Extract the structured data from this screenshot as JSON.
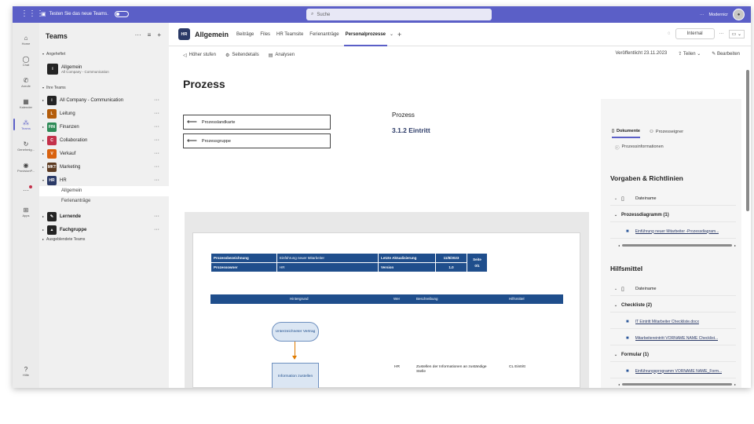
{
  "topbar": {
    "promo_text": "Testen Sie das neue Teams.",
    "search_placeholder": "Suche",
    "more": "···",
    "org": "Modernicr"
  },
  "rail": [
    {
      "id": "home",
      "label": "Home",
      "icon": "home-icon",
      "glyph": "⌂"
    },
    {
      "id": "chat",
      "label": "Chat",
      "icon": "chat-icon",
      "glyph": "◯"
    },
    {
      "id": "anrufe",
      "label": "Anrufe",
      "icon": "phone-icon",
      "glyph": "✆"
    },
    {
      "id": "kalender",
      "label": "Kalender",
      "icon": "calendar-icon",
      "glyph": "▦"
    },
    {
      "id": "teams",
      "label": "Teams",
      "icon": "teams-icon",
      "glyph": "⁂"
    },
    {
      "id": "genehmig",
      "label": "Genehmig...",
      "icon": "approvals-icon",
      "glyph": "↻"
    },
    {
      "id": "provisionpoint",
      "label": "ProvisionP...",
      "icon": "provisionpoint-icon",
      "glyph": "◉"
    },
    {
      "id": "more",
      "label": "",
      "icon": "more-apps-icon",
      "glyph": "···"
    },
    {
      "id": "apps",
      "label": "Apps",
      "icon": "apps-icon",
      "glyph": "⊞"
    }
  ],
  "rail_help": "Hilfe",
  "sidebar": {
    "title": "Teams",
    "pinned_label": "Angeheftet",
    "pinned": {
      "name": "Allgemein",
      "sub": "All Company - Communication"
    },
    "your_teams_label": "Ihre Teams",
    "teams": [
      {
        "name": "All Company - Communication",
        "tile": "i",
        "color": "#242424"
      },
      {
        "name": "Leitung",
        "tile": "L",
        "color": "#b35c0a"
      },
      {
        "name": "Finanzen",
        "tile": "FIN",
        "color": "#2e8b57"
      },
      {
        "name": "Collaboration",
        "tile": "C",
        "color": "#c4314b"
      },
      {
        "name": "Verkauf",
        "tile": "V",
        "color": "#d9620f"
      },
      {
        "name": "Marketing",
        "tile": "MKT",
        "color": "#5c3a21"
      },
      {
        "name": "HR",
        "tile": "HR",
        "color": "#2b3a67"
      }
    ],
    "hr_channels": [
      "Allgemein",
      "Ferienanträge"
    ],
    "teams2": [
      {
        "name": "Lernende",
        "tile": "✎",
        "color": "#242424"
      },
      {
        "name": "Fachgruppe",
        "tile": "▲",
        "color": "#242424"
      }
    ],
    "hidden_label": "Ausgeblendete Teams"
  },
  "channel": {
    "tile": "HR",
    "title": "Allgemein",
    "tabs": [
      "Beiträge",
      "Files",
      "HR Teamsite",
      "Ferienanträge",
      "Personalprozesse"
    ],
    "active_tab": "Personalprozesse",
    "internal_label": "Internal"
  },
  "commandbar": {
    "up": "Höher stufen",
    "details": "Seitendetails",
    "analytics": "Analysen",
    "published": "Veröffentlicht 23.11.2023",
    "share": "Teilen",
    "edit": "Bearbeiten"
  },
  "page": {
    "title": "Prozess",
    "nav_buttons": [
      "Prozesslandkarte",
      "Prozessgruppe"
    ],
    "process_label": "Prozess",
    "process_number": "3.1.2 Eintritt"
  },
  "doc": {
    "header": [
      [
        "Prozessbezeichnung",
        "Einführung neuer Mitarbeiter",
        "Letzte Aktualisierung",
        "11/8/2023"
      ],
      [
        "Prozessowner",
        "HR",
        "Version",
        "1.0"
      ]
    ],
    "seite_label": "Seite",
    "seite_value": "0/1",
    "columns": [
      "Hintergrund",
      "Wer",
      "Beschreibung",
      "Hilfsmittel"
    ],
    "oval": "Unterzeichneter Vertrag",
    "box": "Information zustellen",
    "row_wer": "HR",
    "row_beschreibung": "Zustellen der Informationen an zuständige Stelle",
    "row_hilfsmittel": "CL Eintritt"
  },
  "rightpanel": {
    "tab_docs": "Dokumente",
    "tab_owner": "Prozesseigner",
    "tab_info": "Prozessinformationen",
    "sec1": "Vorgaben & Richtlinien",
    "filename_label": "Dateiname",
    "group1": "Prozessdiagramm (1)",
    "file1": "Einführung neuer Mitarbeiter -Prozessdiagram...",
    "sec2": "Hilfsmittel",
    "group2": "Checkliste (2)",
    "file2": "IT Eintritt Mitarbeiter Checkliste.docx",
    "file3": "Mitarbeitereintritt VORNAME NAME Checklist...",
    "group3": "Formular (1)",
    "file4": "Einführungsprogramm VORNAME NAME_Form..."
  }
}
